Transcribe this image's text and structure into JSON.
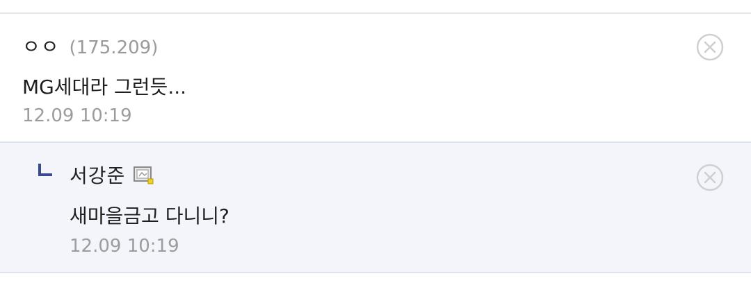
{
  "comments": [
    {
      "nickname": "ㅇㅇ",
      "ip": "(175.209)",
      "text": "MG세대라 그런듯...",
      "timestamp": "12.09 10:19"
    }
  ],
  "replies": [
    {
      "nickname": "서강준",
      "text": "새마을금고 다니니?",
      "timestamp": "12.09 10:19",
      "member_icon": "fixed-nick-icon"
    }
  ],
  "icons": {
    "delete": "close-circle-icon",
    "reply_marker": "reply-arrow-icon"
  },
  "colors": {
    "reply_background": "#f3f5fa",
    "reply_marker": "#3b4a8c",
    "muted_text": "#9c9c9c"
  }
}
